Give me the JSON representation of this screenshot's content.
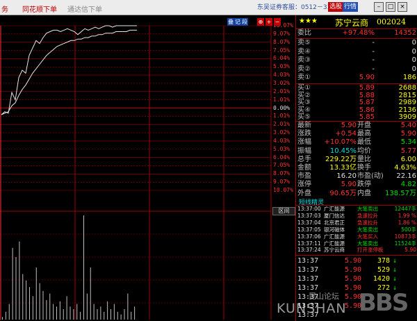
{
  "menubar": {
    "items": [
      "务",
      "同花顺下单",
      "通达信下单"
    ],
    "broker": "东吴证券客服：0512－33396280",
    "tag_a": "选股",
    "tag_b": "行情"
  },
  "chart": {
    "toolbar": [
      "叠",
      "记",
      "段",
      "⊕",
      "+",
      "−"
    ],
    "pct_labels": [
      "10.07%",
      "9.07%",
      "8.07%",
      "7.05%",
      "6.04%",
      "5.03%",
      "4.03%",
      "3.02%",
      "2.01%",
      "1.01%",
      "0.00%",
      "1.01%",
      "2.01%",
      "3.02%",
      "4.03%",
      "5.03%",
      "6.04%",
      "7.05%",
      "8.07%",
      "9.07%",
      "10.07%"
    ],
    "bottom_right_label": "区间",
    "colors": {
      "up": "#ff3030",
      "grid": "#a00000",
      "price": "#e8e8e8",
      "volume": "#c0c0c0"
    }
  },
  "chart_data": {
    "type": "line",
    "series": [
      {
        "values": [
          5.3,
          5.32,
          5.31,
          5.45,
          5.4,
          5.55,
          5.6,
          5.58,
          5.7,
          5.75,
          5.8,
          5.78,
          5.82,
          5.85,
          5.86,
          5.87,
          5.87,
          5.86,
          5.87,
          5.88,
          5.87,
          5.86,
          5.84,
          5.86,
          5.88,
          5.87,
          5.88,
          5.89,
          5.88,
          5.89,
          5.9,
          5.9,
          5.89,
          5.9,
          5.9,
          5.9,
          5.9,
          5.9,
          5.9,
          5.9
        ]
      },
      {
        "values": [
          5.3,
          5.31,
          5.32,
          5.36,
          5.38,
          5.43,
          5.47,
          5.5,
          5.54,
          5.58,
          5.61,
          5.64,
          5.67,
          5.7,
          5.72,
          5.74,
          5.76,
          5.77,
          5.78,
          5.79,
          5.8,
          5.8,
          5.81,
          5.81,
          5.82,
          5.82,
          5.83,
          5.83,
          5.84,
          5.84,
          5.85,
          5.85,
          5.85,
          5.86,
          5.86,
          5.86,
          5.86,
          5.87,
          5.87,
          5.87
        ]
      }
    ],
    "volume": [
      2,
      6,
      12,
      55,
      48,
      60,
      35,
      30,
      25,
      18,
      40,
      28,
      22,
      15,
      20,
      12,
      10,
      14,
      8,
      18,
      10,
      8,
      12,
      6,
      80,
      20,
      40,
      12,
      8,
      10,
      6,
      14,
      8,
      12,
      6,
      4,
      8,
      20,
      6,
      10
    ],
    "ylim": [
      4.82,
      5.9
    ]
  },
  "quote": {
    "stars": "★★★",
    "name": "苏宁云商",
    "code": "002024",
    "weibi": {
      "label": "委比",
      "pct": "+97.48%",
      "val": "14352"
    },
    "sell": [
      {
        "label": "卖⑤",
        "price": "-",
        "vol": "0"
      },
      {
        "label": "卖④",
        "price": "-",
        "vol": "0"
      },
      {
        "label": "卖③",
        "price": "-",
        "vol": "0"
      },
      {
        "label": "卖②",
        "price": "-",
        "vol": "0"
      },
      {
        "label": "卖①",
        "price": "5.90",
        "vol": "186"
      }
    ],
    "buy": [
      {
        "label": "买①",
        "price": "5.89",
        "vol": "2688"
      },
      {
        "label": "买②",
        "price": "5.88",
        "vol": "2815"
      },
      {
        "label": "买③",
        "price": "5.87",
        "vol": "2989"
      },
      {
        "label": "买④",
        "price": "5.86",
        "vol": "2136"
      },
      {
        "label": "买⑤",
        "price": "5.85",
        "vol": "3909"
      }
    ],
    "stats": [
      {
        "l1": "最新",
        "v1": "5.90",
        "c1": "red",
        "l2": "开盘",
        "v2": "5.40",
        "c2": "red"
      },
      {
        "l1": "涨跌",
        "v1": "+0.54",
        "c1": "red",
        "l2": "最高",
        "v2": "5.90",
        "c2": "red"
      },
      {
        "l1": "涨幅",
        "v1": "+10.07%",
        "c1": "red",
        "l2": "最低",
        "v2": "5.34",
        "c2": "green"
      },
      {
        "l1": "振幅",
        "v1": "10.45%",
        "c1": "cyan",
        "l2": "均价",
        "v2": "5.77",
        "c2": "red"
      },
      {
        "l1": "总手",
        "v1": "229.22万",
        "c1": "yellow",
        "l2": "量比",
        "v2": "6.00",
        "c2": "yellow"
      },
      {
        "l1": "金额",
        "v1": "13.33亿",
        "c1": "yellow",
        "l2": "换手",
        "v2": "4.63%",
        "c2": "yellow"
      },
      {
        "l1": "市盈",
        "v1": "16.20",
        "c1": "white",
        "l2": "市盈(动)",
        "v2": "22.16",
        "c2": "white"
      },
      {
        "l1": "涨停",
        "v1": "5.90",
        "c1": "red",
        "l2": "跌停",
        "v2": "4.82",
        "c2": "green"
      },
      {
        "l1": "外盘",
        "v1": "90.65万",
        "c1": "red",
        "l2": "内盘",
        "v2": "138.57万",
        "c2": "green"
      }
    ]
  },
  "sprite": {
    "title": "短线精灵",
    "rows": [
      {
        "time": "13:37:00",
        "name": "广汇能源",
        "event": "大笔卖出",
        "ec": "green",
        "val": "12447手",
        "vc": "green"
      },
      {
        "time": "13:37:03",
        "name": "厦门信达",
        "event": "急速拉升",
        "ec": "red",
        "val": "1.99 %",
        "vc": "red"
      },
      {
        "time": "13:37:04",
        "name": "北京君正",
        "event": "急速拉升",
        "ec": "red",
        "val": "1.86 %",
        "vc": "red"
      },
      {
        "time": "13:37:05",
        "name": "银河磁体",
        "event": "大笔卖出",
        "ec": "green",
        "val": "500手",
        "vc": "green"
      },
      {
        "time": "13:37:06",
        "name": "广汇能源",
        "event": "大笔买入",
        "ec": "red",
        "val": "10873手",
        "vc": "red"
      },
      {
        "time": "13:37:11",
        "name": "广汇能源",
        "event": "大笔卖出",
        "ec": "green",
        "val": "11524手",
        "vc": "green"
      },
      {
        "time": "13:37:24",
        "name": "苏宁云商",
        "event": "打开涨停板",
        "ec": "red",
        "val": "5.90",
        "vc": "red"
      }
    ]
  },
  "ticks": [
    {
      "time": "13:37",
      "price": "5.90",
      "vol": "378",
      "dir": "down"
    },
    {
      "time": "13:37",
      "price": "5.90",
      "vol": "529",
      "dir": "down"
    },
    {
      "time": "13:37",
      "price": "5.90",
      "vol": "1420",
      "dir": "down"
    },
    {
      "time": "13:37",
      "price": "5.90",
      "vol": "272",
      "dir": "down"
    },
    {
      "time": "13:37",
      "price": "5.90",
      "vol": "",
      "dir": ""
    },
    {
      "time": "13:37",
      "price": "5.90",
      "vol": "",
      "dir": ""
    },
    {
      "time": "13:37",
      "price": "",
      "vol": "",
      "dir": ""
    }
  ],
  "watermark": {
    "cn": "昆山论坛",
    "en": "KUNSHAN",
    "bbs": "BBS"
  }
}
